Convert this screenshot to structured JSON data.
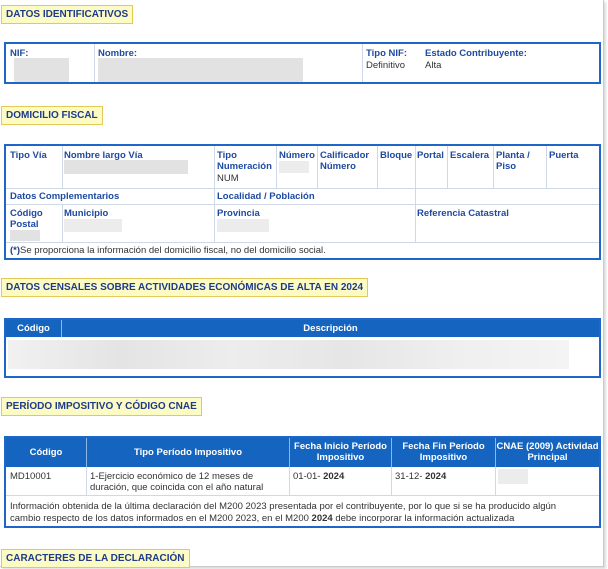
{
  "sections": {
    "datos_identificativos": "DATOS IDENTIFICATIVOS",
    "domicilio_fiscal": "DOMICILIO FISCAL",
    "datos_censales": "DATOS CENSALES SOBRE ACTIVIDADES ECONÓMICAS DE ALTA EN",
    "datos_censales_year": "2024",
    "periodo": "PERÍODO IMPOSITIVO Y CÓDIGO CNAE",
    "caracteres": "CARACTERES DE LA DECLARACIÓN"
  },
  "identificativos": {
    "nif_label": "NIF:",
    "nombre_label": "Nombre:",
    "tipo_nif_label": "Tipo NIF:",
    "tipo_nif_value": "Definitivo",
    "estado_label": "Estado Contribuyente:",
    "estado_value": "Alta"
  },
  "domicilio": {
    "tipo_via": "Tipo Vía",
    "nombre_largo_via": "Nombre largo Vía",
    "tipo_numeracion": "Tipo Numeración",
    "tipo_numeracion_value": "NUM",
    "numero": "Número",
    "calificador_numero": "Calificador Número",
    "bloque": "Bloque",
    "portal": "Portal",
    "escalera": "Escalera",
    "planta_piso": "Planta / Piso",
    "puerta": "Puerta",
    "datos_complementarios": "Datos Complementarios",
    "localidad": "Localidad / Población",
    "codigo_postal": "Código Postal",
    "municipio": "Municipio",
    "provincia": "Provincia",
    "referencia_catastral": "Referencia Catastral",
    "nota_marker": "(*)",
    "nota": "Se proporciona la información del domicilio fiscal, no del domicilio social."
  },
  "censales": {
    "col_codigo": "Código",
    "col_descripcion": "Descripción"
  },
  "periodo": {
    "col_codigo": "Código",
    "col_tipo": "Tipo Período Impositivo",
    "col_fecha_inicio": "Fecha Inicio Período Impositivo",
    "col_fecha_fin": "Fecha Fin Período Impositivo",
    "col_cnae": "CNAE (2009) Actividad Principal",
    "row_codigo": "MD10001",
    "row_tipo": "1-Ejercicio económico de 12 meses de duración, que coincida con el año natural",
    "row_inicio_prefix": "01-01-",
    "row_inicio_year": "2024",
    "row_fin_prefix": "31-12-",
    "row_fin_year": "2024",
    "info_1": "Información obtenida de la última declaración del M200 2023 presentada por el contribuyente, por lo que si se ha producido algún",
    "info_2a": "cambio respecto de los datos informados en el M200 2023, en el M200",
    "info_2_year": "2024",
    "info_2b": "debe incorporar la información actualizada"
  }
}
